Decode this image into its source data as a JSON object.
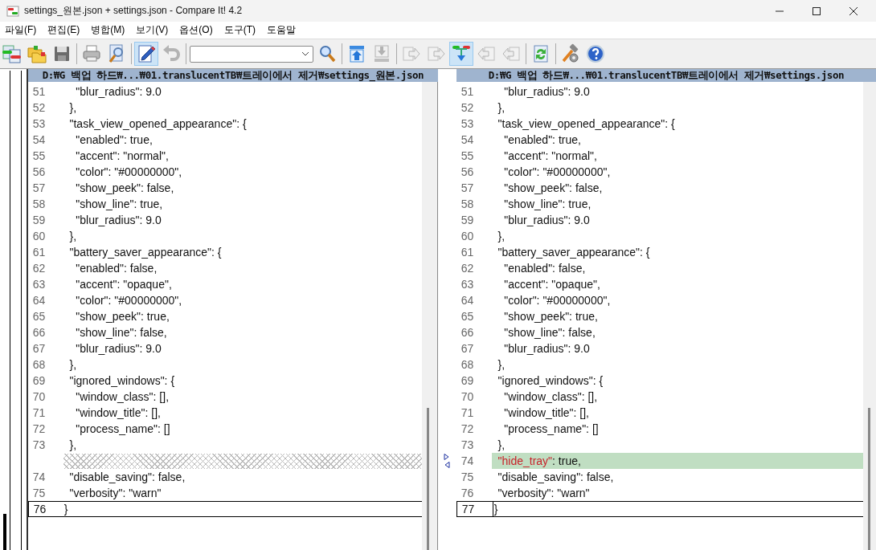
{
  "window": {
    "title": "settings_원본.json + settings.json - Compare It! 4.2"
  },
  "menu": [
    "파일(F)",
    "편집(E)",
    "병합(M)",
    "보기(V)",
    "옵션(O)",
    "도구(T)",
    "도움말"
  ],
  "toolbar": [
    {
      "kind": "compare-files",
      "pressed": false,
      "disabled": false
    },
    {
      "kind": "compare-folders",
      "pressed": false,
      "disabled": false
    },
    {
      "kind": "save",
      "pressed": false,
      "disabled": false
    },
    {
      "kind": "sep"
    },
    {
      "kind": "print",
      "pressed": false,
      "disabled": false
    },
    {
      "kind": "preview",
      "pressed": false,
      "disabled": false
    },
    {
      "kind": "sep"
    },
    {
      "kind": "edit",
      "pressed": true,
      "disabled": false
    },
    {
      "kind": "undo",
      "pressed": false,
      "disabled": true
    },
    {
      "kind": "sep"
    },
    {
      "kind": "combo"
    },
    {
      "kind": "search",
      "pressed": false,
      "disabled": false
    },
    {
      "kind": "sep"
    },
    {
      "kind": "upload",
      "pressed": false,
      "disabled": false
    },
    {
      "kind": "download",
      "pressed": false,
      "disabled": true
    },
    {
      "kind": "sep"
    },
    {
      "kind": "copy-right",
      "pressed": false,
      "disabled": true
    },
    {
      "kind": "copy-right",
      "pressed": false,
      "disabled": true
    },
    {
      "kind": "next-diff",
      "pressed": true,
      "disabled": false
    },
    {
      "kind": "copy-left",
      "pressed": false,
      "disabled": true
    },
    {
      "kind": "copy-left",
      "pressed": false,
      "disabled": true
    },
    {
      "kind": "sep"
    },
    {
      "kind": "refresh",
      "pressed": false,
      "disabled": false
    },
    {
      "kind": "sep"
    },
    {
      "kind": "tools",
      "pressed": false,
      "disabled": false
    },
    {
      "kind": "help",
      "pressed": false,
      "disabled": false
    }
  ],
  "left_pane": {
    "path": "D:₩G 백업 하드₩...₩01.translucentTB₩트레이에서 제거₩settings_원본.json",
    "lines": [
      {
        "kind": "plain",
        "number": "51",
        "text": "    \"blur_radius\": 9.0"
      },
      {
        "kind": "plain",
        "number": "52",
        "text": "  },"
      },
      {
        "kind": "plain",
        "number": "53",
        "text": "  \"task_view_opened_appearance\": {"
      },
      {
        "kind": "plain",
        "number": "54",
        "text": "    \"enabled\": true,"
      },
      {
        "kind": "plain",
        "number": "55",
        "text": "    \"accent\": \"normal\","
      },
      {
        "kind": "plain",
        "number": "56",
        "text": "    \"color\": \"#00000000\","
      },
      {
        "kind": "plain",
        "number": "57",
        "text": "    \"show_peek\": false,"
      },
      {
        "kind": "plain",
        "number": "58",
        "text": "    \"show_line\": true,"
      },
      {
        "kind": "plain",
        "number": "59",
        "text": "    \"blur_radius\": 9.0"
      },
      {
        "kind": "plain",
        "number": "60",
        "text": "  },"
      },
      {
        "kind": "plain",
        "number": "61",
        "text": "  \"battery_saver_appearance\": {"
      },
      {
        "kind": "plain",
        "number": "62",
        "text": "    \"enabled\": false,"
      },
      {
        "kind": "plain",
        "number": "63",
        "text": "    \"accent\": \"opaque\","
      },
      {
        "kind": "plain",
        "number": "64",
        "text": "    \"color\": \"#00000000\","
      },
      {
        "kind": "plain",
        "number": "65",
        "text": "    \"show_peek\": true,"
      },
      {
        "kind": "plain",
        "number": "66",
        "text": "    \"show_line\": false,"
      },
      {
        "kind": "plain",
        "number": "67",
        "text": "    \"blur_radius\": 9.0"
      },
      {
        "kind": "plain",
        "number": "68",
        "text": "  },"
      },
      {
        "kind": "plain",
        "number": "69",
        "text": "  \"ignored_windows\": {"
      },
      {
        "kind": "plain",
        "number": "70",
        "text": "    \"window_class\": [],"
      },
      {
        "kind": "plain",
        "number": "71",
        "text": "    \"window_title\": [],"
      },
      {
        "kind": "plain",
        "number": "72",
        "text": "    \"process_name\": []"
      },
      {
        "kind": "plain",
        "number": "73",
        "text": "  },"
      },
      {
        "kind": "filler"
      },
      {
        "kind": "plain",
        "number": "74",
        "text": "  \"disable_saving\": false,"
      },
      {
        "kind": "plain",
        "number": "75",
        "text": "  \"verbosity\": \"warn\""
      },
      {
        "kind": "current",
        "number": "76",
        "text": "}"
      }
    ]
  },
  "right_pane": {
    "path": "D:₩G 백업 하드₩...₩01.translucentTB₩트레이에서 제거₩settings.json",
    "lines": [
      {
        "kind": "plain",
        "number": "51",
        "text": "    \"blur_radius\": 9.0"
      },
      {
        "kind": "plain",
        "number": "52",
        "text": "  },"
      },
      {
        "kind": "plain",
        "number": "53",
        "text": "  \"task_view_opened_appearance\": {"
      },
      {
        "kind": "plain",
        "number": "54",
        "text": "    \"enabled\": true,"
      },
      {
        "kind": "plain",
        "number": "55",
        "text": "    \"accent\": \"normal\","
      },
      {
        "kind": "plain",
        "number": "56",
        "text": "    \"color\": \"#00000000\","
      },
      {
        "kind": "plain",
        "number": "57",
        "text": "    \"show_peek\": false,"
      },
      {
        "kind": "plain",
        "number": "58",
        "text": "    \"show_line\": true,"
      },
      {
        "kind": "plain",
        "number": "59",
        "text": "    \"blur_radius\": 9.0"
      },
      {
        "kind": "plain",
        "number": "60",
        "text": "  },"
      },
      {
        "kind": "plain",
        "number": "61",
        "text": "  \"battery_saver_appearance\": {"
      },
      {
        "kind": "plain",
        "number": "62",
        "text": "    \"enabled\": false,"
      },
      {
        "kind": "plain",
        "number": "63",
        "text": "    \"accent\": \"opaque\","
      },
      {
        "kind": "plain",
        "number": "64",
        "text": "    \"color\": \"#00000000\","
      },
      {
        "kind": "plain",
        "number": "65",
        "text": "    \"show_peek\": true,"
      },
      {
        "kind": "plain",
        "number": "66",
        "text": "    \"show_line\": false,"
      },
      {
        "kind": "plain",
        "number": "67",
        "text": "    \"blur_radius\": 9.0"
      },
      {
        "kind": "plain",
        "number": "68",
        "text": "  },"
      },
      {
        "kind": "plain",
        "number": "69",
        "text": "  \"ignored_windows\": {"
      },
      {
        "kind": "plain",
        "number": "70",
        "text": "    \"window_class\": [],"
      },
      {
        "kind": "plain",
        "number": "71",
        "text": "    \"window_title\": [],"
      },
      {
        "kind": "plain",
        "number": "72",
        "text": "    \"process_name\": []"
      },
      {
        "kind": "plain",
        "number": "73",
        "text": "  },"
      },
      {
        "kind": "added",
        "number": "74",
        "changed": "  \"hide_tray\"",
        "text": ": true,"
      },
      {
        "kind": "plain",
        "number": "75",
        "text": "  \"disable_saving\": false,"
      },
      {
        "kind": "plain",
        "number": "76",
        "text": "  \"verbosity\": \"warn\""
      },
      {
        "kind": "current",
        "number": "77",
        "text": "}"
      }
    ]
  }
}
